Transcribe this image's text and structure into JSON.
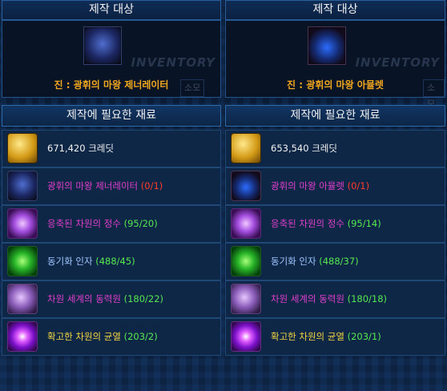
{
  "panels": [
    {
      "header": "제작 대상",
      "inventory_label": "INVENTORY",
      "target": {
        "icon": "helmet-icon",
        "prefix": "진 : ",
        "name": "광휘의 마왕 제너레이터"
      },
      "materials_header": "제작에 필요한 재료",
      "materials": [
        {
          "icon": "gold-coin-icon",
          "name": "671,420 크레딧",
          "count": ""
        },
        {
          "icon": "helmet-icon",
          "name": "광휘의 마왕 제너레이터",
          "count": "(0/1)"
        },
        {
          "icon": "essence-crystal-icon",
          "name": "응축된 차원의 정수",
          "count": "(95/20)"
        },
        {
          "icon": "sync-factor-icon",
          "name": "동기화 인자",
          "count": "(488/45)"
        },
        {
          "icon": "power-source-icon",
          "name": "차원 세계의 동력원",
          "count": "(180/22)"
        },
        {
          "icon": "rift-icon",
          "name": "확고한 차원의 균열",
          "count": "(203/2)"
        }
      ]
    },
    {
      "header": "제작 대상",
      "inventory_label": "INVENTORY",
      "target": {
        "icon": "amulet-icon",
        "prefix": "진 : ",
        "name": "광휘의 마왕 아뮬렛"
      },
      "materials_header": "제작에 필요한 재료",
      "materials": [
        {
          "icon": "gold-coin-icon",
          "name": "653,540 크레딧",
          "count": ""
        },
        {
          "icon": "amulet-icon",
          "name": "광휘의 마왕 아뮬렛",
          "count": "(0/1)"
        },
        {
          "icon": "essence-crystal-icon",
          "name": "응축된 차원의 정수",
          "count": "(95/14)"
        },
        {
          "icon": "sync-factor-icon",
          "name": "동기화 인자",
          "count": "(488/37)"
        },
        {
          "icon": "power-source-icon",
          "name": "차원 세계의 동력원",
          "count": "(180/18)"
        },
        {
          "icon": "rift-icon",
          "name": "확고한 차원의 균열",
          "count": "(203/1)"
        }
      ]
    }
  ],
  "ghost_labels": [
    "소모",
    "소모"
  ],
  "colors": {
    "target_name": "#f2a81e",
    "material_name_item": "#e03ecb",
    "count_missing": "#ff3a2a",
    "count_ok": "#56e84e",
    "material_name_rift": "#f4d640"
  }
}
